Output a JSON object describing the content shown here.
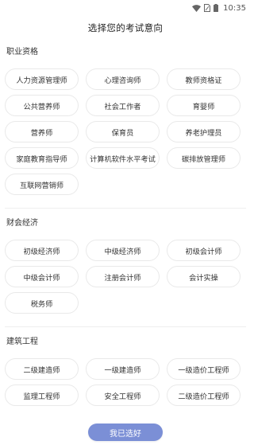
{
  "status_bar": {
    "time": "10:35",
    "icons": [
      "wifi-icon",
      "sim-icon",
      "battery-icon"
    ]
  },
  "header": {
    "title": "选择您的考试意向"
  },
  "sections": [
    {
      "title": "职业资格",
      "tags": [
        "人力资源管理师",
        "心理咨询师",
        "教师资格证",
        "公共营养师",
        "社会工作者",
        "育婴师",
        "营养师",
        "保育员",
        "养老护理员",
        "家庭教育指导师",
        "计算机软件水平考试",
        "碳排放管理师",
        "互联网营销师"
      ]
    },
    {
      "title": "财会经济",
      "tags": [
        "初级经济师",
        "中级经济师",
        "初级会计师",
        "中级会计师",
        "注册会计师",
        "会计实操",
        "税务师"
      ]
    },
    {
      "title": "建筑工程",
      "tags": [
        "二级建造师",
        "一级建造师",
        "一级造价工程师",
        "监理工程师",
        "安全工程师",
        "二级造价工程师"
      ]
    }
  ],
  "footer": {
    "confirm_label": "我已选好"
  },
  "colors": {
    "accent": "#7b8fd6",
    "tag_border": "#e9e9e9",
    "divider": "#eeeeee"
  }
}
